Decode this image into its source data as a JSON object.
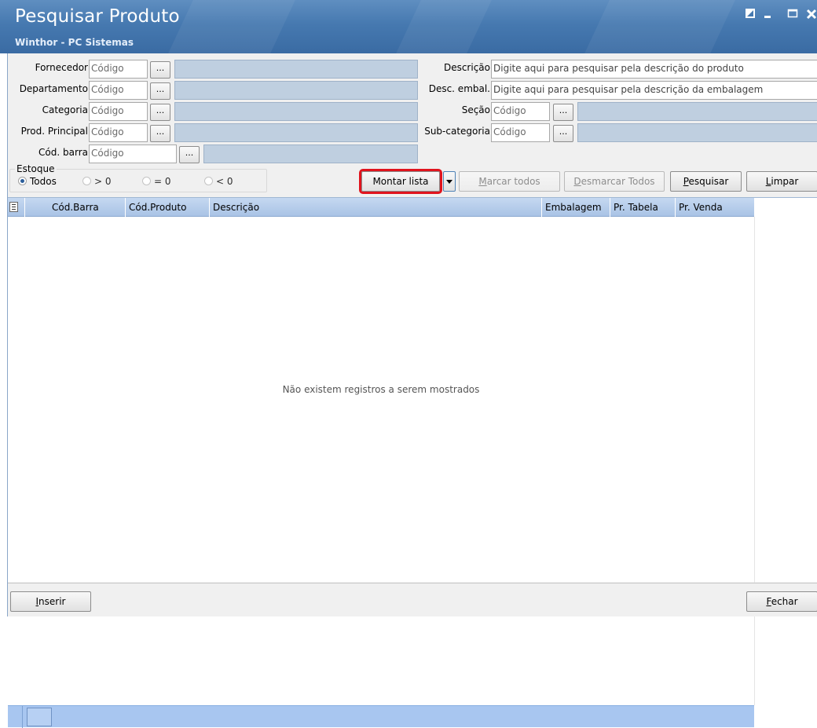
{
  "window": {
    "title": "Pesquisar Produto",
    "subtitle": "Winthor - PC Sistemas",
    "controls": [
      "restore-icon",
      "minimize-icon",
      "maximize-icon",
      "close-icon"
    ]
  },
  "filters": {
    "fornecedor": {
      "label": "Fornecedor",
      "placeholder": "Código",
      "lookup": "..."
    },
    "departamento": {
      "label": "Departamento",
      "placeholder": "Código",
      "lookup": "..."
    },
    "categoria": {
      "label": "Categoria",
      "placeholder": "Código",
      "lookup": "..."
    },
    "prod_principal": {
      "label": "Prod. Principal",
      "placeholder": "Código",
      "lookup": "..."
    },
    "cod_barra": {
      "label": "Cód. barra",
      "placeholder": "Código",
      "lookup": "..."
    },
    "descricao": {
      "label": "Descrição",
      "placeholder": "Digite aqui para pesquisar pela descrição do produto"
    },
    "desc_embal": {
      "label": "Desc. embal.",
      "placeholder": "Digite aqui para pesquisar pela descrição da embalagem"
    },
    "secao": {
      "label": "Seção",
      "placeholder": "Código",
      "lookup": "..."
    },
    "subcategoria": {
      "label": "Sub-categoria",
      "placeholder": "Código",
      "lookup": "..."
    }
  },
  "estoque": {
    "title": "Estoque",
    "options": [
      "Todos",
      "> 0",
      "= 0",
      "< 0"
    ],
    "selected": "Todos"
  },
  "actions": {
    "montar_lista": "Montar lista",
    "marcar_todos": "Marcar todos",
    "desmarcar_todos": "Desmarcar Todos",
    "pesquisar": "Pesquisar",
    "limpar": "Limpar"
  },
  "grid": {
    "columns": [
      "Cód.Barra",
      "Cód.Produto",
      "Descrição",
      "Embalagem",
      "Pr. Tabela",
      "Pr. Venda"
    ],
    "empty_message": "Não existem registros a serem mostrados"
  },
  "footer": {
    "inserir": "Inserir",
    "fechar": "Fechar"
  },
  "colors": {
    "titlebar": "#4679b0",
    "grid_header": "#a9c3e5",
    "grid_footer": "#a8c6f0",
    "highlight": "#e0141d"
  }
}
